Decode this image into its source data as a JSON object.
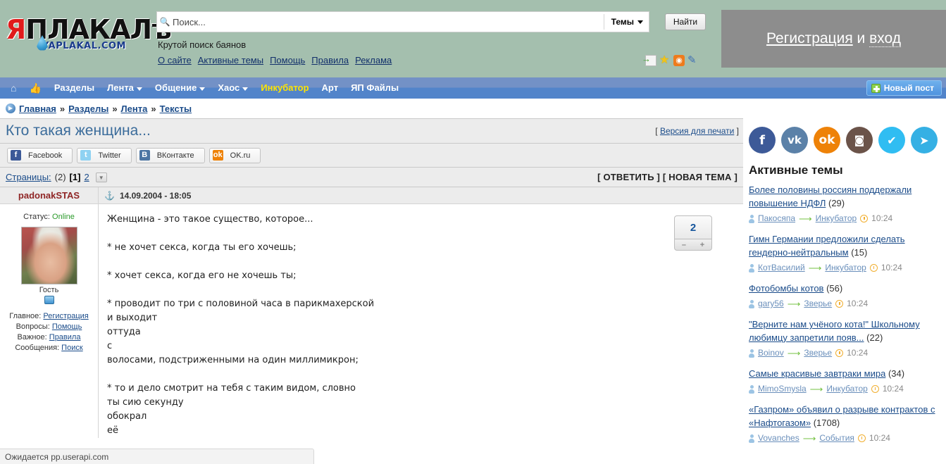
{
  "header": {
    "logo_main_ya": "Я",
    "logo_main_rest": "ПЛАКАЛ",
    "logo_hard_sign": "ъ",
    "logo_sub": "YAPLAKAL.COM",
    "search": {
      "placeholder": "Поиск...",
      "value": "",
      "icon": "search-icon",
      "scope_label": "Темы",
      "button_label": "Найти"
    },
    "tagline": "Крутой поиск баянов",
    "links": [
      "О сайте",
      "Активные темы",
      "Помощь",
      "Правила",
      "Реклама"
    ],
    "small_icons": [
      "new-post-icon",
      "star-icon",
      "rss-icon",
      "pencil-icon"
    ],
    "register": {
      "link_label": "Регистрация",
      "middle": " и ",
      "login_label": "вход"
    }
  },
  "nav": {
    "home_icon": "home-icon",
    "thumb_icon": "thumbs-up-icon",
    "items": [
      {
        "label": "Разделы",
        "caret": false,
        "accent": false
      },
      {
        "label": "Лента",
        "caret": true,
        "accent": false
      },
      {
        "label": "Общение",
        "caret": true,
        "accent": false
      },
      {
        "label": "Хаос",
        "caret": true,
        "accent": false
      },
      {
        "label": "Инкубатор",
        "caret": false,
        "accent": true
      },
      {
        "label": "Арт",
        "caret": false,
        "accent": false
      },
      {
        "label": "ЯП Файлы",
        "caret": false,
        "accent": false
      }
    ],
    "new_post_label": "Новый пост"
  },
  "breadcrumb": {
    "items": [
      "Главная",
      "Разделы",
      "Лента",
      "Тексты"
    ],
    "separator": "»"
  },
  "topic": {
    "title": "Кто такая женщина...",
    "print_open": "[",
    "print_label": "Версия для печати",
    "print_close": "]",
    "social_buttons": [
      {
        "label": "Facebook",
        "glyph": "f",
        "key": "fb"
      },
      {
        "label": "Twitter",
        "glyph": "t",
        "key": "tw"
      },
      {
        "label": "ВКонтакте",
        "glyph": "B",
        "key": "vk"
      },
      {
        "label": "OK.ru",
        "glyph": "ok",
        "key": "ok"
      }
    ],
    "pages_label": "Страницы:",
    "pages_count": "(2)",
    "page_current": "[1]",
    "page_next": "2",
    "reply_label": "[ ОТВЕТИТЬ ]",
    "newtopic_label": "[ НОВАЯ ТЕМА ]"
  },
  "post": {
    "author": "padonakSTAS",
    "status_label": "Статус:",
    "status_value": "Online",
    "avatar_caption": "Гость",
    "info_rows": [
      {
        "label": "Главное:",
        "link": "Регистрация"
      },
      {
        "label": "Вопросы:",
        "link": "Помощь"
      },
      {
        "label": "Важное:",
        "link": "Правила"
      },
      {
        "label": "Сообщения:",
        "link": "Поиск"
      }
    ],
    "datetime": "14.09.2004 - 18:05",
    "anchor_icon": "anchor-icon",
    "rating_value": "2",
    "rating_minus": "–",
    "rating_plus": "+",
    "paragraphs": [
      "Женщина - это такое существо, которое...",
      "* не хочет секса, когда ты его хочешь;",
      "* хочет секса, когда его не хочешь ты;",
      "* проводит по три с половиной часа в парикмахерской\nи выходит\nоттуда\nс\nволосами, подстриженными на один миллимикрон;",
      "* то и дело смотрит на тебя с таким видом, словно\nты сию секунду\nобокрал\nеё"
    ]
  },
  "sidebar": {
    "social": [
      {
        "key": "fb",
        "glyph": "f",
        "name": "facebook-icon"
      },
      {
        "key": "vk",
        "glyph": "vk",
        "name": "vk-icon"
      },
      {
        "key": "ok",
        "glyph": "ok",
        "name": "odnoklassniki-icon"
      },
      {
        "key": "ig",
        "glyph": "◙",
        "name": "instagram-icon"
      },
      {
        "key": "tw",
        "glyph": "✔",
        "name": "twitter-icon"
      },
      {
        "key": "tg",
        "glyph": "➤",
        "name": "telegram-icon"
      }
    ],
    "title": "Активные темы",
    "topics": [
      {
        "title": "Более половины россиян поддержали повышение НДФЛ",
        "count": "(29)",
        "author": "Пакосяпа",
        "section": "Инкубатор",
        "time": "10:24"
      },
      {
        "title": "Гимн Германии предложили сделать гендерно-нейтральным",
        "count": "(15)",
        "author": "КотВасилий",
        "section": "Инкубатор",
        "time": "10:24"
      },
      {
        "title": "Фотобомбы котов",
        "count": "(56)",
        "author": "gary56",
        "section": "Зверье",
        "time": "10:24"
      },
      {
        "title": "\"Верните нам учёного кота!\" Школьному любимцу запретили появ...",
        "count": "(22)",
        "author": "Boinov",
        "section": "Зверье",
        "time": "10:24"
      },
      {
        "title": "Самые красивые завтраки мира",
        "count": "(34)",
        "author": "MimoSmysla",
        "section": "Инкубатор",
        "time": "10:24"
      },
      {
        "title": "«Газпром» объявил о разрыве контрактов с «Нафтогазом»",
        "count": "(1708)",
        "author": "Vovanches",
        "section": "События",
        "time": "10:24"
      }
    ]
  },
  "statusbar": {
    "text": "Ожидается pp.userapi.com"
  },
  "colors": {
    "header_bg": "#a4bfae",
    "nav_top": "#7391c6",
    "nav_bottom": "#5284ca",
    "accent_yellow": "#ffe400",
    "link_blue": "#1b4c8a",
    "title_blue": "#3b6c9b",
    "author_red": "#8f2525",
    "online_green": "#2a9a2a",
    "reg_box_bg": "#8d8d8d"
  }
}
